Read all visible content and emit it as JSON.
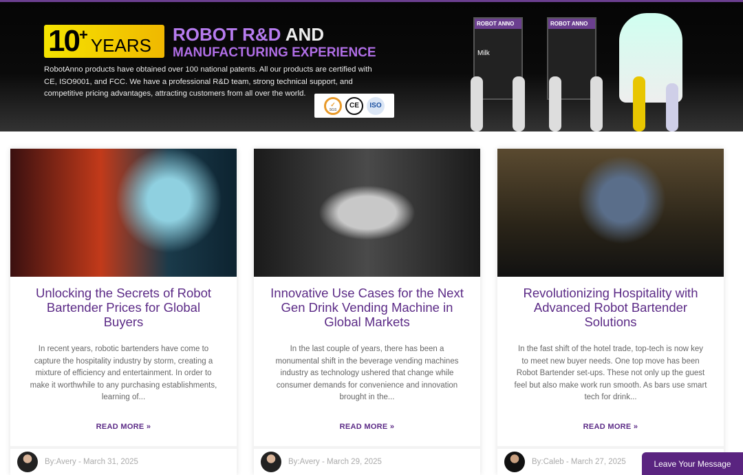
{
  "banner": {
    "badge_number": "10",
    "badge_plus": "+",
    "badge_years": "YEARS",
    "headline_purple": "ROBOT R&D",
    "headline_white": "AND",
    "headline_line2": "MANUFACTURING EXPERIENCE",
    "description": "RobotAnno products have obtained over 100 national patents. All our products are certified with CE, ISO9001, and FCC. We have a professional R&D team, strong technical support, and competitive pricing advantages, attracting customers from all over the world.",
    "cert_logos": [
      "SGS",
      "CE",
      "ISO"
    ],
    "machine_brand": "ROBOT ANNO",
    "machine_label": "Milk"
  },
  "cards": [
    {
      "title": "Unlocking the Secrets of Robot Bartender Prices for Global Buyers",
      "excerpt": "In recent years, robotic bartenders have come to capture the hospitality industry by storm, creating a mixture of efficiency and entertainment. In order to make it worthwhile to any purchasing establishments, learning of...",
      "read_more": "READ MORE »",
      "meta": "By:Avery - March 31, 2025"
    },
    {
      "title": "Innovative Use Cases for the Next Gen Drink Vending Machine in Global Markets",
      "excerpt": "In the last couple of years, there has been a monumental shift in the beverage vending machines industry as technology ushered that change while consumer demands for convenience and innovation brought in the...",
      "read_more": "READ MORE »",
      "meta": "By:Avery - March 29, 2025"
    },
    {
      "title": "Revolutionizing Hospitality with Advanced Robot Bartender Solutions",
      "excerpt": "In the fast shift of the hotel trade, top-tech is now key to meet new buyer needs. One top move has been Robot Bartender set-ups. These not only up the guest feel but also make work run smooth. As bars use smart tech for drink...",
      "read_more": "READ MORE »",
      "meta": "By:Caleb - March 27, 2025"
    }
  ],
  "leave_message": "Leave Your Message",
  "colors": {
    "accent": "#5b2a86",
    "headline": "#b77cf0",
    "badge": "#f5e400"
  }
}
